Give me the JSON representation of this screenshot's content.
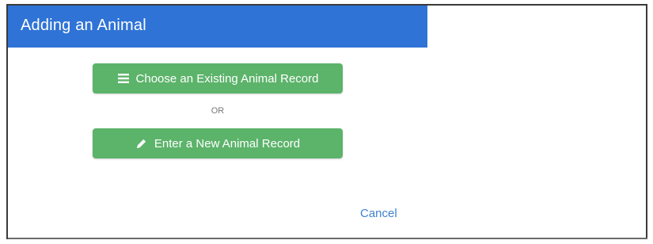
{
  "dialog": {
    "title": "Adding an Animal",
    "header_color": "#2f73d6",
    "choose_existing": {
      "label": "Choose an Existing Animal Record",
      "icon": "list-icon"
    },
    "separator": "OR",
    "enter_new": {
      "label": "Enter a New Animal Record",
      "icon": "pencil-icon"
    },
    "button_color": "#5cb36a",
    "cancel_label": "Cancel",
    "cancel_color": "#3e82cf"
  }
}
